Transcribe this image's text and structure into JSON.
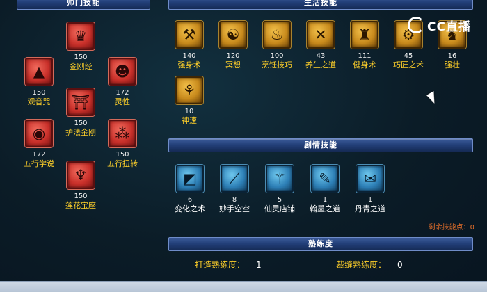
{
  "sections": {
    "sect": "师门技能",
    "life": "生活技能",
    "story": "剧情技能",
    "proficiency": "熟练度"
  },
  "sect_skills": [
    {
      "name": "金刚经",
      "level": "150",
      "icon": "stupa-crown-icon"
    },
    {
      "name": "观音咒",
      "level": "150",
      "icon": "pagoda-icon"
    },
    {
      "name": "灵性",
      "level": "172",
      "icon": "buddha-head-icon"
    },
    {
      "name": "护法金刚",
      "level": "150",
      "icon": "guardian-gate-icon"
    },
    {
      "name": "五行学说",
      "level": "172",
      "icon": "five-elements-circle-icon"
    },
    {
      "name": "五行扭转",
      "level": "150",
      "icon": "five-elements-dots-icon"
    },
    {
      "name": "莲花宝座",
      "level": "150",
      "icon": "lotus-throne-icon"
    }
  ],
  "life_skills": [
    {
      "name": "强身术",
      "level": "140",
      "icon": "fortify-body-icon"
    },
    {
      "name": "冥想",
      "level": "120",
      "icon": "meditation-icon"
    },
    {
      "name": "烹饪技巧",
      "level": "100",
      "icon": "cooking-icon"
    },
    {
      "name": "养生之道",
      "level": "43",
      "icon": "health-cultivation-icon"
    },
    {
      "name": "健身术",
      "level": "111",
      "icon": "fitness-icon"
    },
    {
      "name": "巧匠之术",
      "level": "45",
      "icon": "craftsman-icon"
    },
    {
      "name": "强壮",
      "level": "16",
      "icon": "strength-icon"
    },
    {
      "name": "神速",
      "level": "10",
      "icon": "swiftness-icon"
    }
  ],
  "story_skills": [
    {
      "name": "变化之术",
      "level": "6",
      "icon": "transformation-icon"
    },
    {
      "name": "妙手空空",
      "level": "8",
      "icon": "pickpocket-icon"
    },
    {
      "name": "仙灵店铺",
      "level": "5",
      "icon": "fairy-shop-icon"
    },
    {
      "name": "翰墨之道",
      "level": "1",
      "icon": "ink-brush-icon"
    },
    {
      "name": "丹青之道",
      "level": "1",
      "icon": "painting-scroll-icon"
    }
  ],
  "remaining_points": {
    "label": "剩余技能点：",
    "value": "0"
  },
  "proficiency": {
    "forging_label": "打造熟练度：",
    "forging_value": "1",
    "tailoring_label": "裁缝熟练度：",
    "tailoring_value": "0"
  },
  "watermark": {
    "text": "CC直播",
    "mark": "cc"
  },
  "colors": {
    "skill_name": "#ffd02a",
    "header_bar": "#23407a",
    "remaining": "#e06d2a"
  }
}
